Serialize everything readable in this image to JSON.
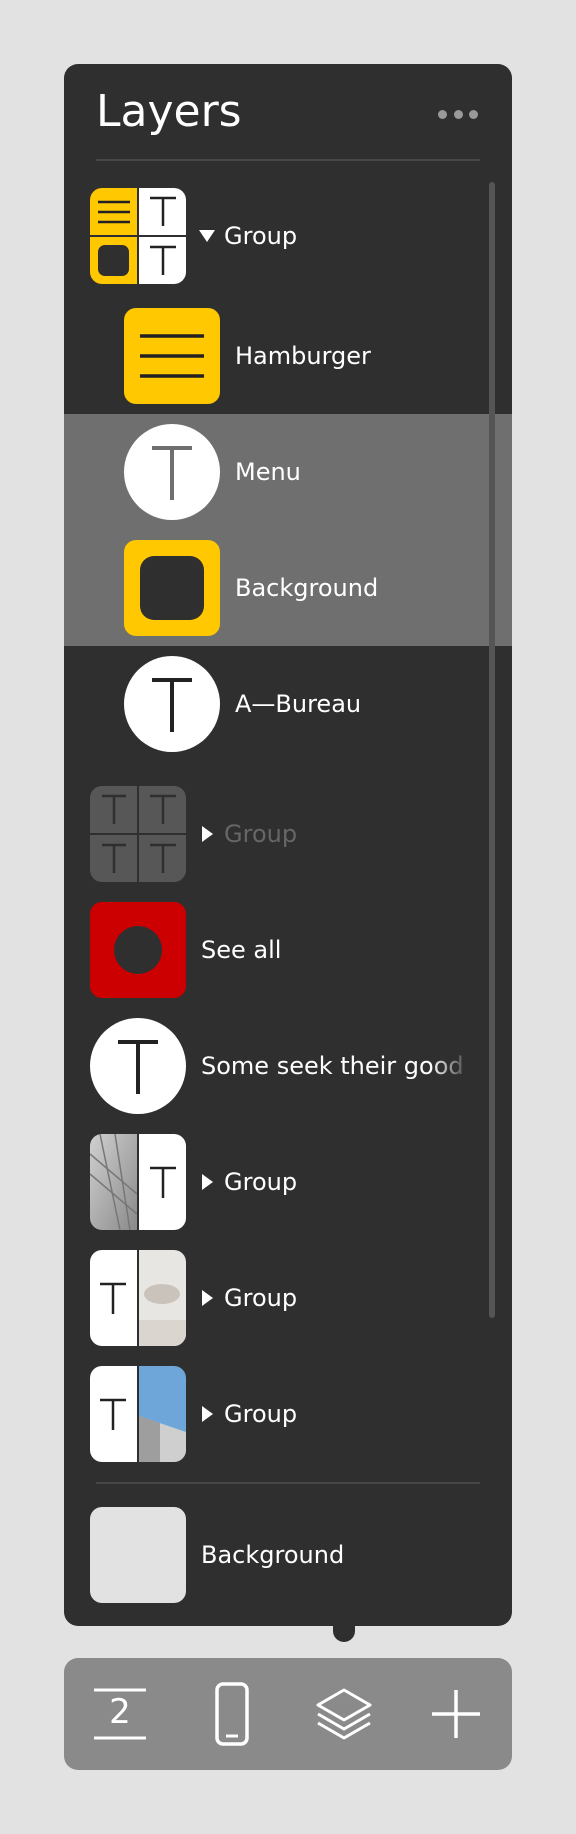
{
  "panel": {
    "title": "Layers",
    "more_icon": "more-horizontal-icon",
    "background": "#2f2f2f",
    "selection_color": "#6f6f6f",
    "accent_yellow": "#ffc800",
    "accent_red": "#cc0000"
  },
  "layers": [
    {
      "label": "Group",
      "expanded": true,
      "thumb": "group-yellow-mixed"
    },
    {
      "label": "Hamburger",
      "thumb": "hamburger-icon"
    },
    {
      "label": "Menu",
      "thumb": "text-icon",
      "selected": true
    },
    {
      "label": "Background",
      "thumb": "rounded-square-icon",
      "selected": true
    },
    {
      "label": "A—Bureau",
      "thumb": "text-icon"
    },
    {
      "label": "Group",
      "expanded": false,
      "hidden": true,
      "thumb": "group-text-grid"
    },
    {
      "label": "See all",
      "thumb": "red-circle-icon"
    },
    {
      "label": "Some seek their good c",
      "thumb": "text-icon"
    },
    {
      "label": "Group",
      "expanded": false,
      "thumb": "group-photo-text"
    },
    {
      "label": "Group",
      "expanded": false,
      "thumb": "group-text-photo"
    },
    {
      "label": "Group",
      "expanded": false,
      "thumb": "group-text-building"
    },
    {
      "label": "Background",
      "thumb": "light-gray-swatch"
    }
  ],
  "toolbar": {
    "page_number": "2",
    "buttons": [
      "pages-icon",
      "device-icon",
      "layers-icon",
      "add-icon"
    ]
  }
}
